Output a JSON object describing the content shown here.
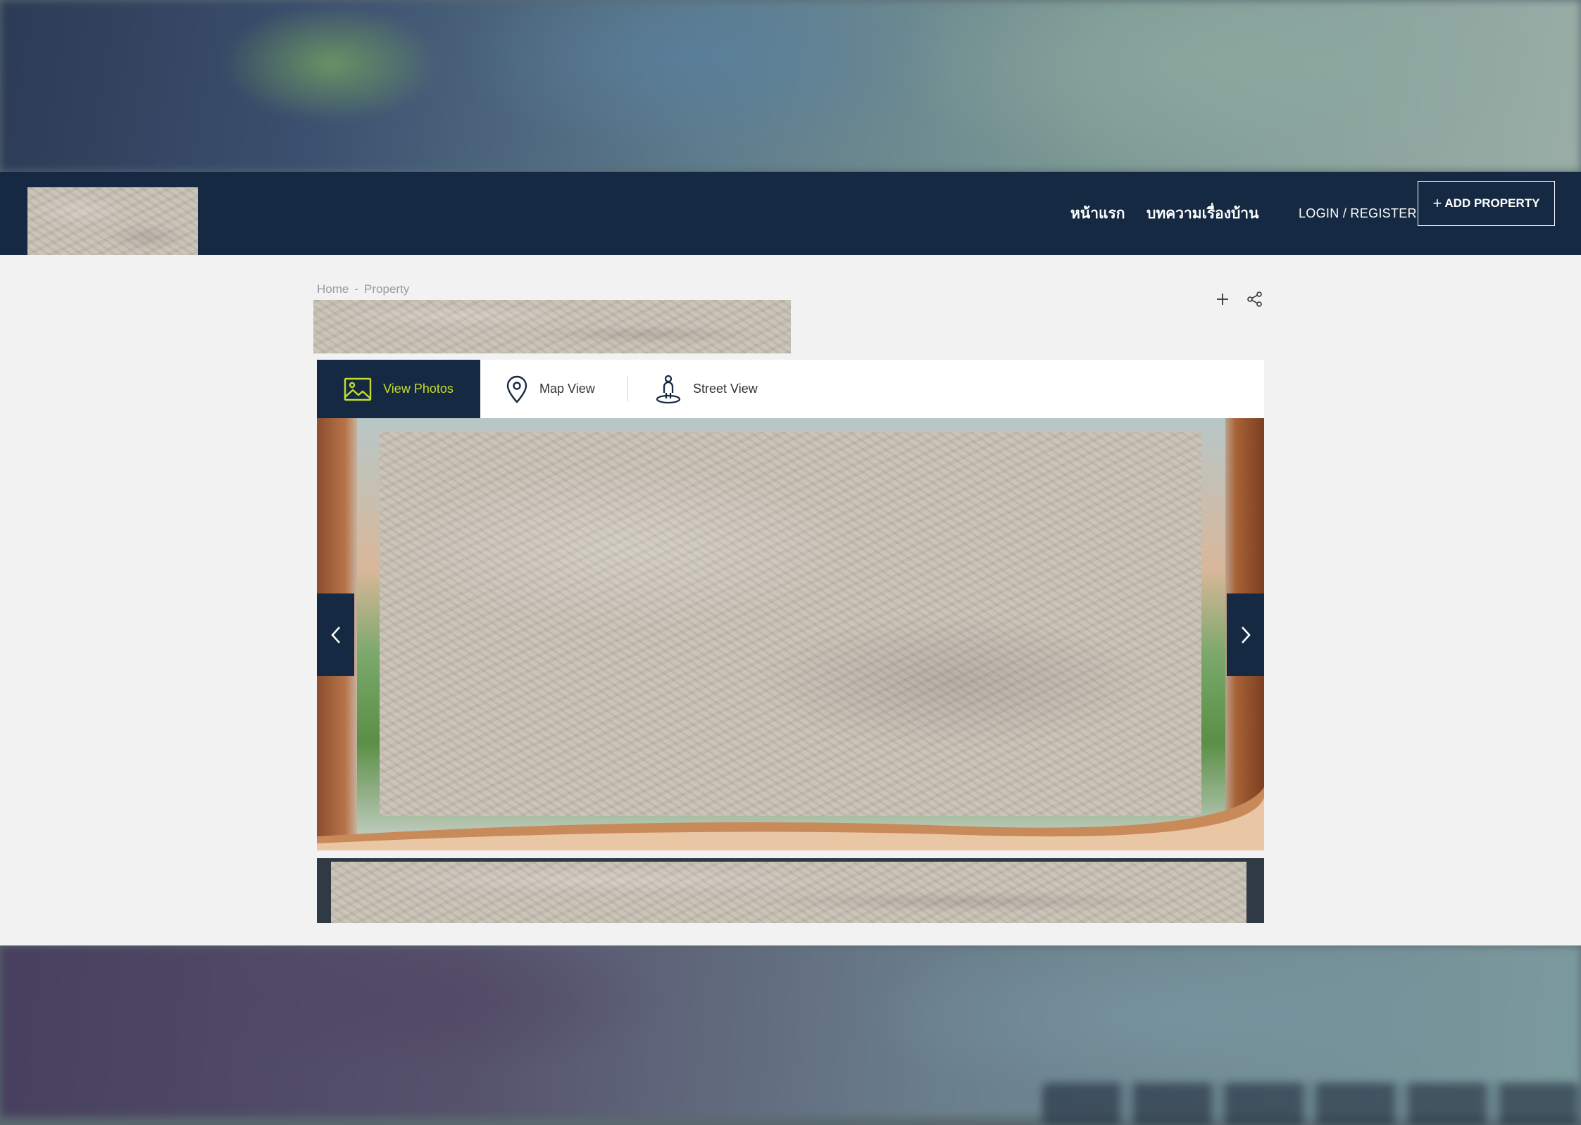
{
  "header": {
    "nav": {
      "home": "หน้าแรก",
      "articles": "บทความเรื่องบ้าน",
      "login_register": "LOGIN / REGISTER"
    },
    "add_property": {
      "icon": "+",
      "label": "ADD PROPERTY"
    }
  },
  "breadcrumb": {
    "items": [
      "Home",
      "-",
      "Property"
    ]
  },
  "actions": {
    "favorite_icon": "plus-icon",
    "share_icon": "share-icon"
  },
  "tabs": [
    {
      "label": "View Photos",
      "icon": "image-icon",
      "active": true
    },
    {
      "label": "Map View",
      "icon": "map-pin-icon",
      "active": false
    },
    {
      "label": "Street View",
      "icon": "street-view-icon",
      "active": false
    }
  ],
  "colors": {
    "navy": "#152a42",
    "accent": "#c5dc2a",
    "content_bg": "#f2f2f2"
  }
}
